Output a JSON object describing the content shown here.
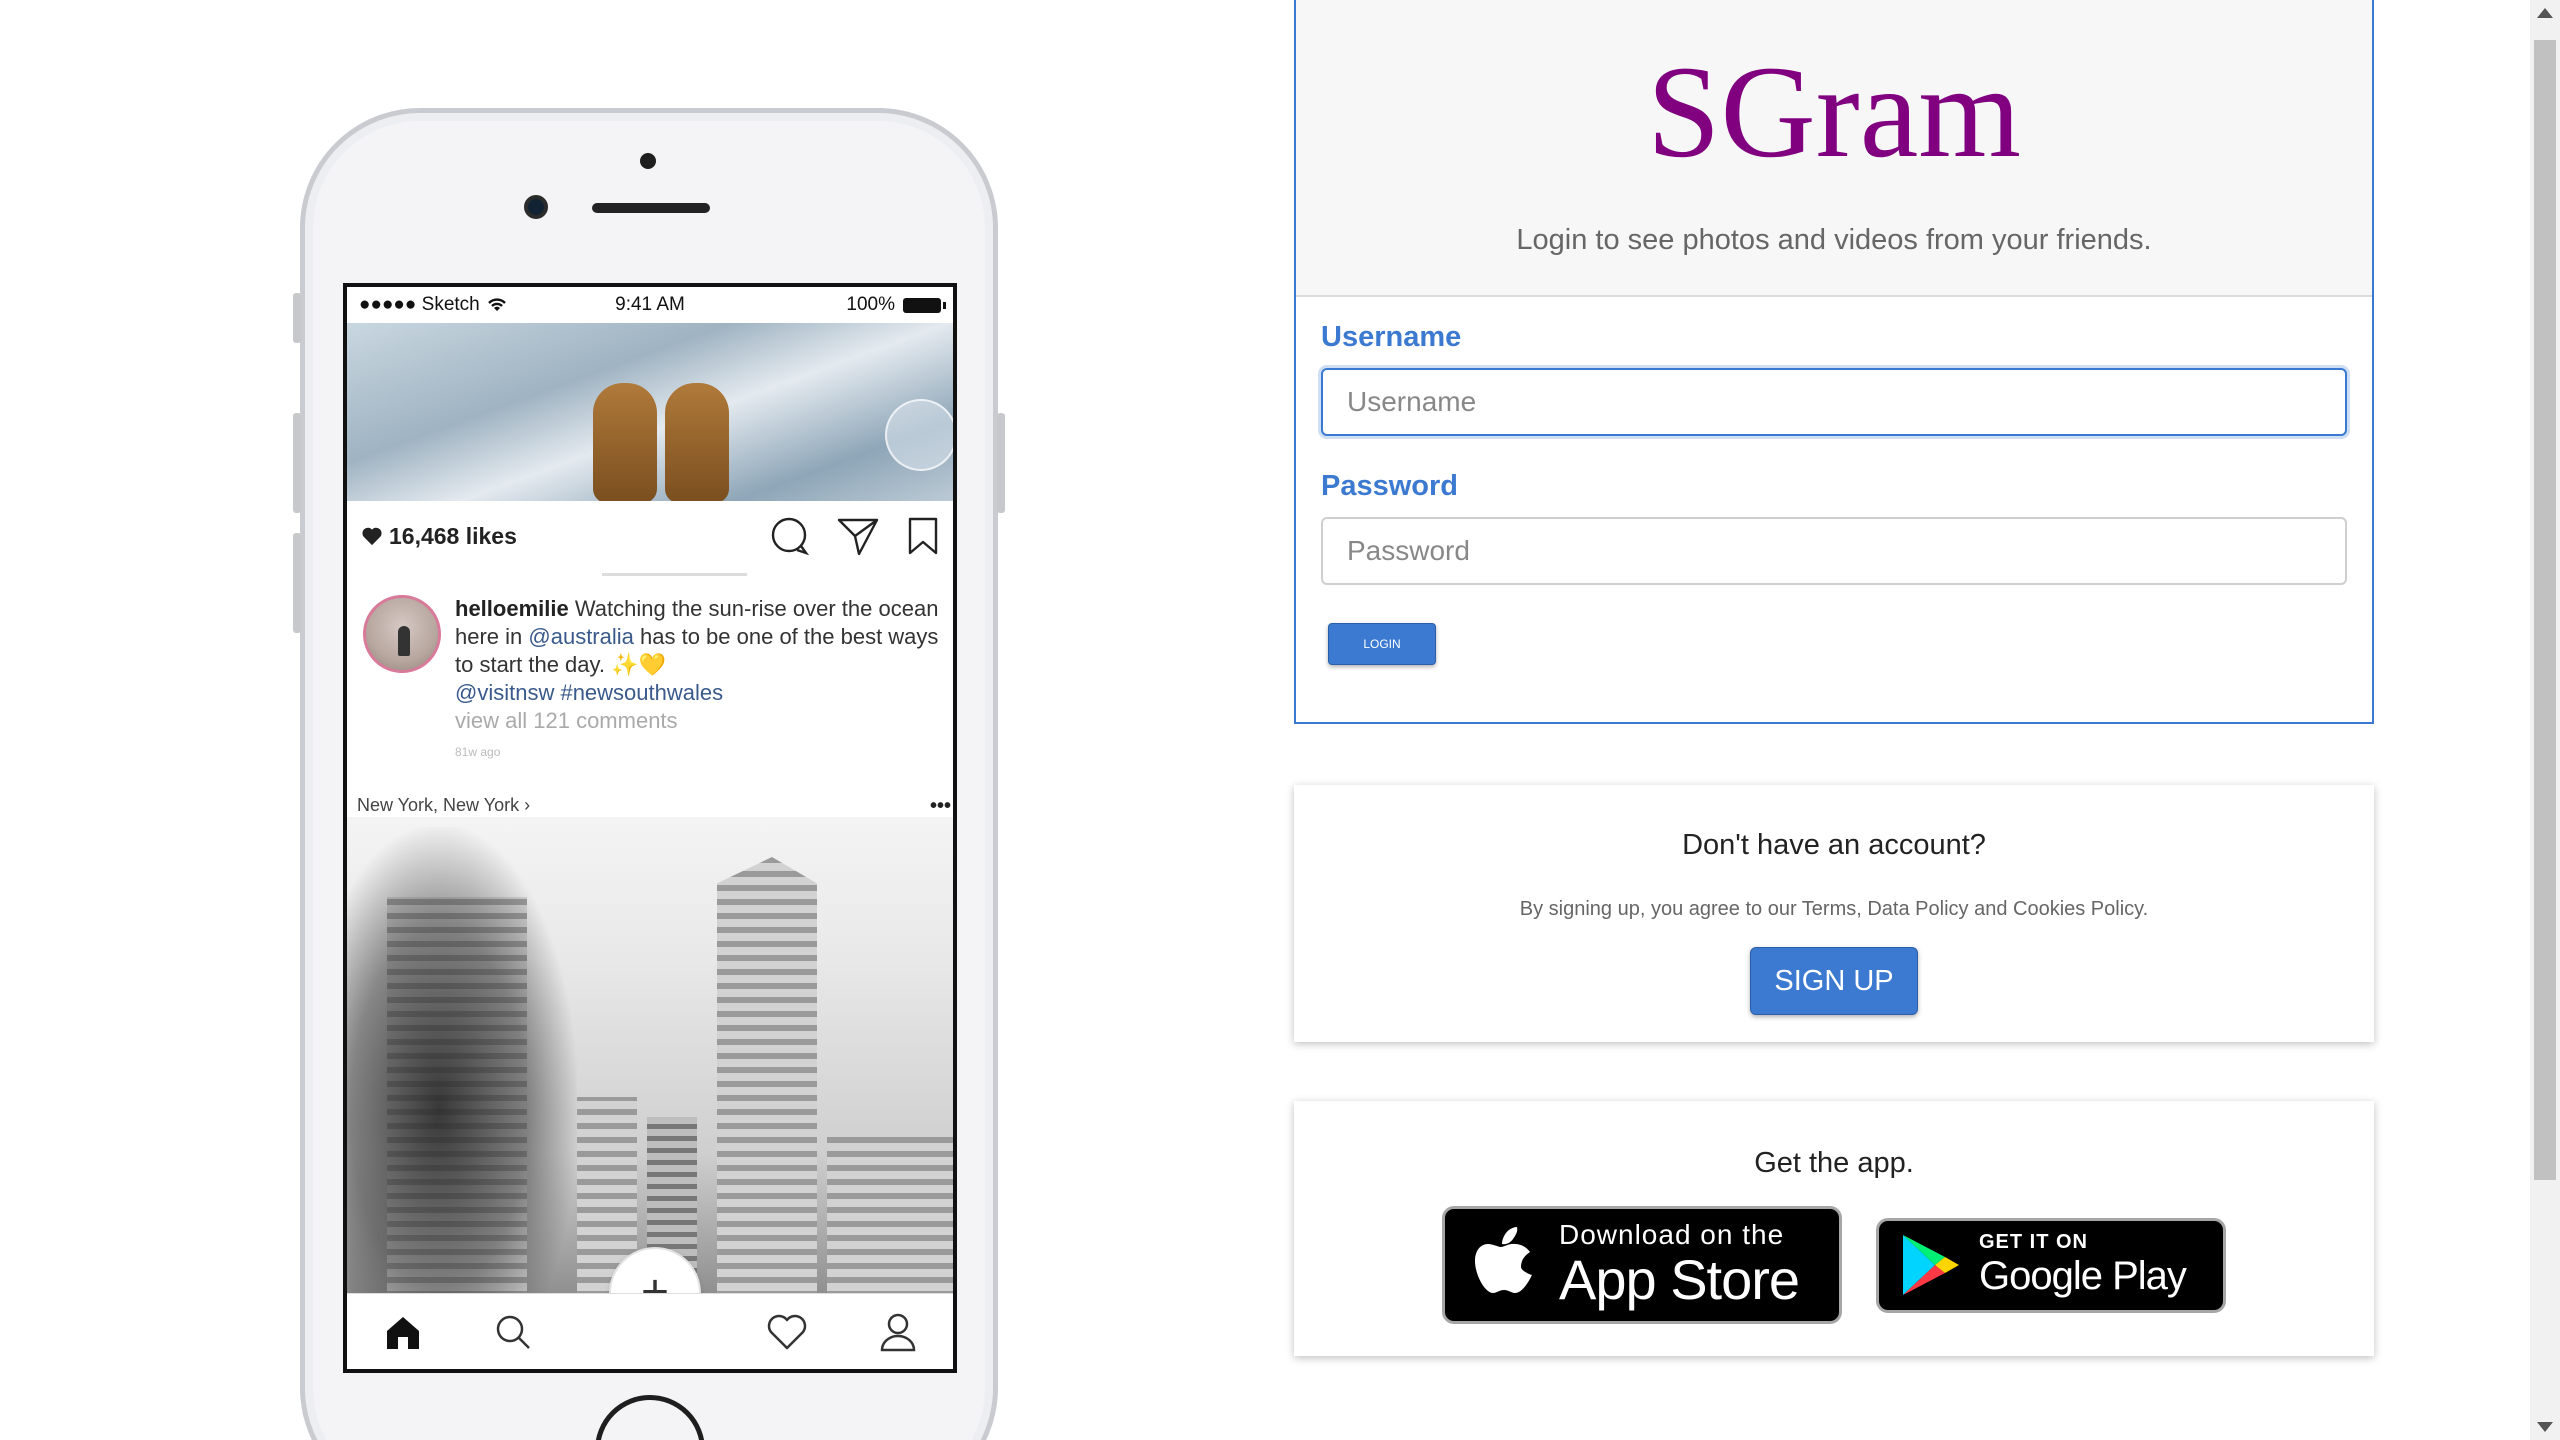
{
  "phone": {
    "status": {
      "carrier": "●●●●● Sketch",
      "time": "9:41 AM",
      "battery": "100%"
    },
    "post": {
      "likes": "16,468 likes",
      "username": "helloemilie",
      "caption_pre": " Watching the sun-rise over the ocean here in ",
      "mention": "@australia",
      "caption_post": " has to be one of the best ways to start the day. ✨💛",
      "tags": "@visitnsw #newsouthwales",
      "comments": "view all 121 comments",
      "ago": "81w ago"
    },
    "location": "New York, New York",
    "more": "•••",
    "plus": "+"
  },
  "login": {
    "brand": "SGram",
    "tagline": "Login to see photos and videos from your friends.",
    "username_label": "Username",
    "username_placeholder": "Username",
    "password_label": "Password",
    "password_placeholder": "Password",
    "login_button": "LOGIN"
  },
  "signup": {
    "title": "Don't have an account?",
    "terms": "By signing up, you agree to our Terms, Data Policy and Cookies Policy.",
    "button": "SIGN UP"
  },
  "app": {
    "title": "Get the app.",
    "appstore_small": "Download on the",
    "appstore_big": "App Store",
    "google_small": "GET IT ON",
    "google_big": "Google Play"
  },
  "colors": {
    "brand": "#800080",
    "accent": "#3b7ad0"
  }
}
